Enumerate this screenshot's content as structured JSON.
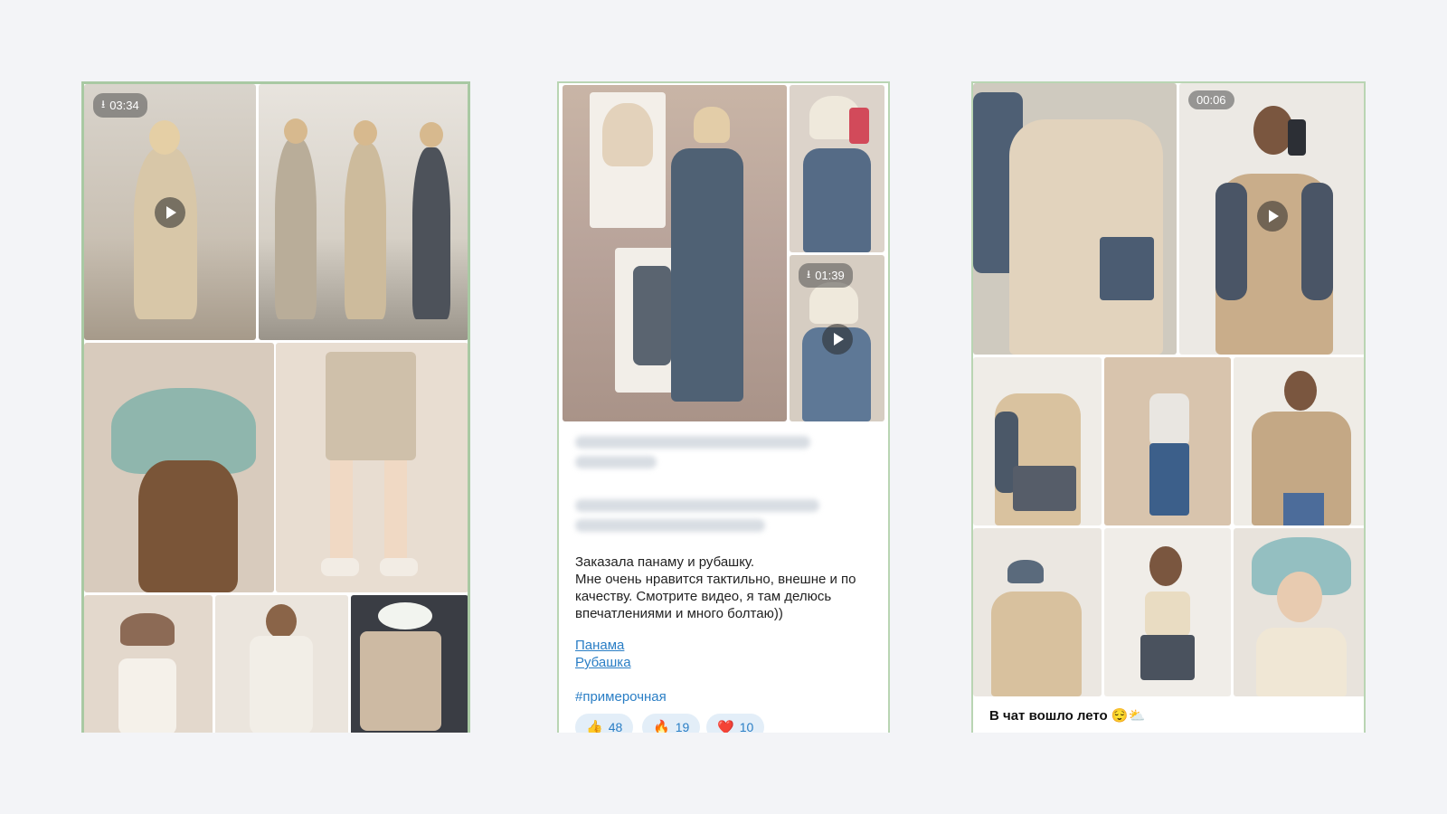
{
  "card1": {
    "video_badge": {
      "icon": "download-arrow-icon",
      "duration": "03:34"
    }
  },
  "card2": {
    "video_badge": {
      "icon": "download-arrow-icon",
      "duration": "01:39"
    },
    "message": "Заказала панаму и рубашку.\nМне очень нравится тактильно, внешне и по качеству. Смотрите видео, я там делюсь впечатлениями и много болтаю))",
    "links": [
      "Панама",
      "Рубашка"
    ],
    "hashtag": "#примерочная",
    "reactions": [
      {
        "emoji": "👍",
        "count": "48"
      },
      {
        "emoji": "🔥",
        "count": "19"
      },
      {
        "emoji": "❤️",
        "count": "10"
      }
    ]
  },
  "card3": {
    "video_badge": {
      "duration": "00:06"
    },
    "caption": "В чат вошло лето 😌⛅"
  },
  "colors": {
    "background": "#f3f4f7",
    "card_border": "#a9c9a3",
    "link": "#2a7ec5",
    "reaction_bg": "#e3eef8"
  }
}
